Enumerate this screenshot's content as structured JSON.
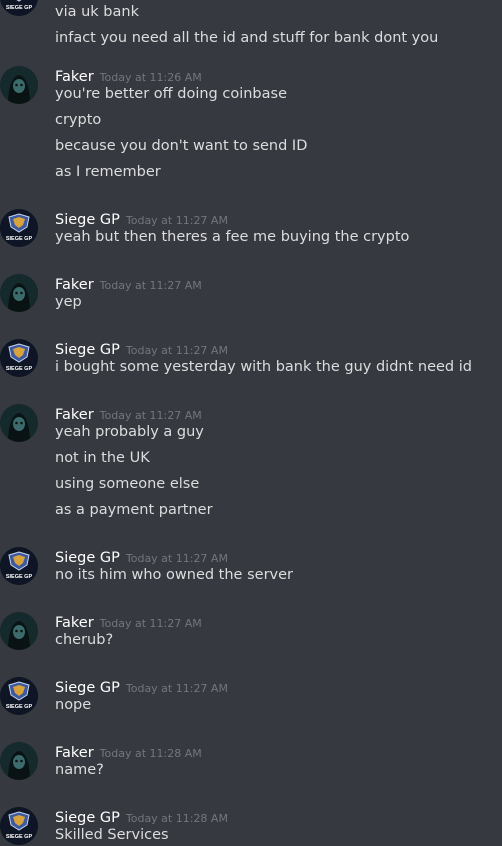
{
  "colors": {
    "background": "#36393f",
    "text": "#dcddde",
    "author": "#ffffff",
    "timestamp": "#72767d"
  },
  "avatars": {
    "siege_label": "SIEGE GP"
  },
  "orphan_lines": [
    "via uk bank",
    "infact you need all the id and stuff for bank dont you"
  ],
  "groups": [
    {
      "author": "Faker",
      "avatar": "faker",
      "timestamp": "Today at 11:26 AM",
      "lines": [
        "you're better off doing coinbase",
        "crypto",
        "because you don't want to send ID",
        "as I remember"
      ]
    },
    {
      "author": "Siege GP",
      "avatar": "siege",
      "timestamp": "Today at 11:27 AM",
      "lines": [
        "yeah but then theres a fee me buying the crypto"
      ]
    },
    {
      "author": "Faker",
      "avatar": "faker",
      "timestamp": "Today at 11:27 AM",
      "lines": [
        "yep"
      ]
    },
    {
      "author": "Siege GP",
      "avatar": "siege",
      "timestamp": "Today at 11:27 AM",
      "lines": [
        "i bought some yesterday with bank the guy didnt need id"
      ]
    },
    {
      "author": "Faker",
      "avatar": "faker",
      "timestamp": "Today at 11:27 AM",
      "lines": [
        "yeah probably a guy",
        "not in the UK",
        "using someone else",
        "as a payment partner"
      ]
    },
    {
      "author": "Siege GP",
      "avatar": "siege",
      "timestamp": "Today at 11:27 AM",
      "lines": [
        "no its him who owned the server"
      ]
    },
    {
      "author": "Faker",
      "avatar": "faker",
      "timestamp": "Today at 11:27 AM",
      "lines": [
        "cherub?"
      ]
    },
    {
      "author": "Siege GP",
      "avatar": "siege",
      "timestamp": "Today at 11:27 AM",
      "lines": [
        "nope"
      ]
    },
    {
      "author": "Faker",
      "avatar": "faker",
      "timestamp": "Today at 11:28 AM",
      "lines": [
        "name?"
      ]
    },
    {
      "author": "Siege GP",
      "avatar": "siege",
      "timestamp": "Today at 11:28 AM",
      "lines": [
        "Skilled Services"
      ]
    }
  ]
}
